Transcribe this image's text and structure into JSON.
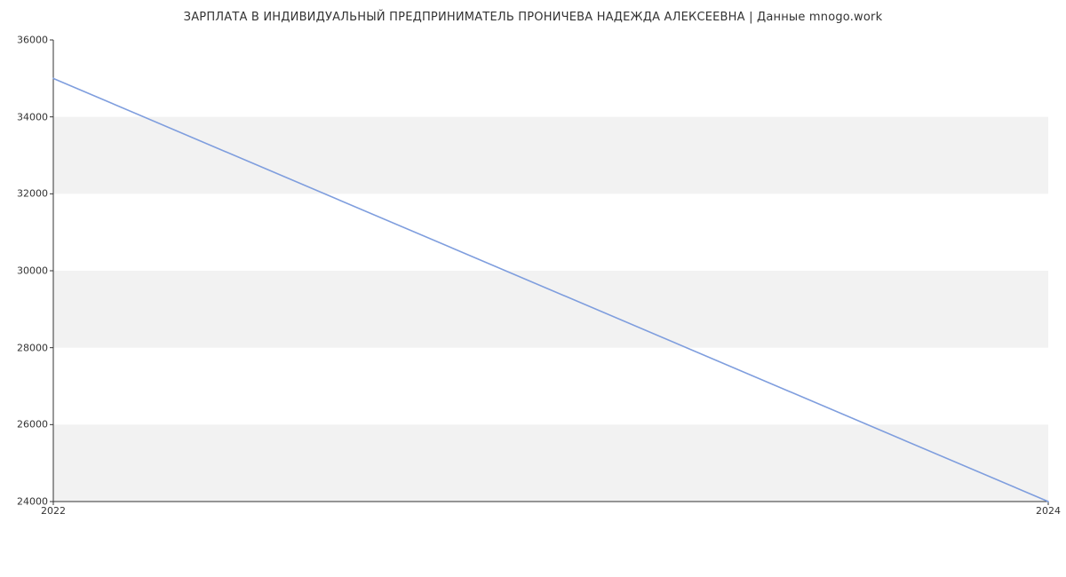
{
  "chart_data": {
    "type": "line",
    "title": "ЗАРПЛАТА В ИНДИВИДУАЛЬНЫЙ ПРЕДПРИНИМАТЕЛЬ ПРОНИЧЕВА НАДЕЖДА АЛЕКСЕЕВНА | Данные mnogo.work",
    "xlabel": "",
    "ylabel": "",
    "x": [
      2022,
      2024
    ],
    "values": [
      35000,
      24000
    ],
    "x_ticks": [
      2022,
      2024
    ],
    "y_ticks": [
      24000,
      26000,
      28000,
      30000,
      32000,
      34000,
      36000
    ],
    "xlim": [
      2022,
      2024
    ],
    "ylim": [
      24000,
      36000
    ],
    "line_color": "#7f9ede",
    "grid_color": "#f2f2f2",
    "axis_color": "#333333"
  }
}
